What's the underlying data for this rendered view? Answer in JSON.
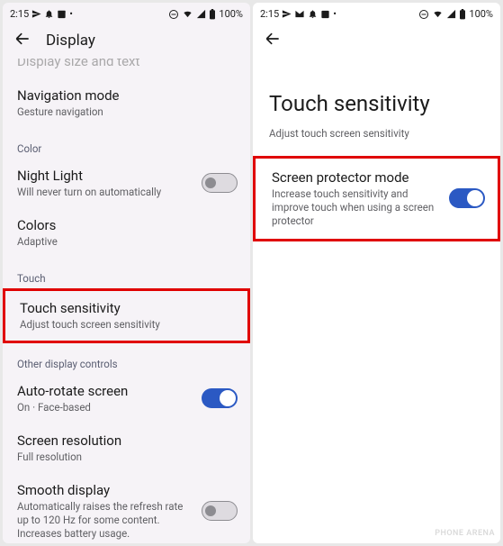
{
  "status": {
    "time": "2:15",
    "battery": "100%"
  },
  "left": {
    "appbar_title": "Display",
    "cutoff_text": "Display size and text",
    "nav_mode": {
      "title": "Navigation mode",
      "sub": "Gesture navigation"
    },
    "section_color": "Color",
    "night_light": {
      "title": "Night Light",
      "sub": "Will never turn on automatically"
    },
    "colors": {
      "title": "Colors",
      "sub": "Adaptive"
    },
    "section_touch": "Touch",
    "touch_sens": {
      "title": "Touch sensitivity",
      "sub": "Adjust touch screen sensitivity"
    },
    "section_other": "Other display controls",
    "autorotate": {
      "title": "Auto-rotate screen",
      "sub": "On · Face-based"
    },
    "resolution": {
      "title": "Screen resolution",
      "sub": "Full resolution"
    },
    "smooth": {
      "title": "Smooth display",
      "sub": "Automatically raises the refresh rate up to 120 Hz for some content. Increases battery usage."
    }
  },
  "right": {
    "page_title": "Touch sensitivity",
    "page_sub": "Adjust touch screen sensitivity",
    "protector": {
      "title": "Screen protector mode",
      "sub": "Increase touch sensitivity and improve touch when using a screen protector"
    }
  },
  "watermark": "PHONE ARENA"
}
